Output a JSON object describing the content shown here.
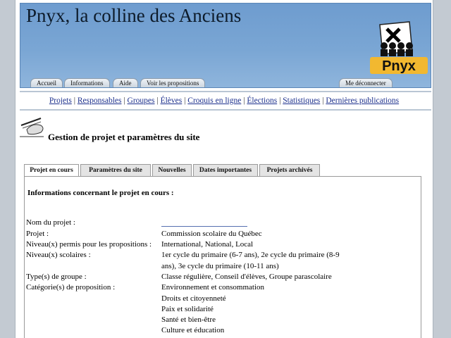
{
  "site": {
    "title": "Pnyx, la colline des Anciens",
    "logo_text": "Pnyx"
  },
  "header_tabs": [
    {
      "label": "Accueil"
    },
    {
      "label": "Informations"
    },
    {
      "label": "Aide"
    },
    {
      "label": "Voir les propositions"
    },
    {
      "label": "Me déconnecter"
    }
  ],
  "nav": [
    {
      "label": "Projets"
    },
    {
      "label": "Responsables"
    },
    {
      "label": "Groupes"
    },
    {
      "label": "Élèves"
    },
    {
      "label": "Croquis en ligne"
    },
    {
      "label": "Élections"
    },
    {
      "label": "Statistiques"
    },
    {
      "label": "Dernières publications"
    }
  ],
  "page": {
    "title": "Gestion de projet et paramètres du site"
  },
  "project_tabs": [
    {
      "label": "Projet en cours",
      "active": true
    },
    {
      "label": "Paramètres du site"
    },
    {
      "label": "Nouvelles"
    },
    {
      "label": "Dates importantes"
    },
    {
      "label": "Projets archivés"
    }
  ],
  "panel": {
    "heading": "Informations concernant le projet en cours :",
    "fields": [
      {
        "label": "Nom du projet :",
        "value": ""
      },
      {
        "label": "Projet :",
        "value": "Commission scolaire du Québec"
      },
      {
        "label": "Niveau(x) permis pour les propositions :",
        "value": "International, National, Local"
      },
      {
        "label": "Niveau(x) scolaires :",
        "value": "1er cycle du primaire (6-7 ans), 2e cycle du primaire (8-9",
        "value2": "ans), 3e cycle du primaire (10-11 ans)"
      },
      {
        "label": "Type(s) de groupe :",
        "value": "Classe régulière, Conseil d'élèves, Groupe parascolaire"
      },
      {
        "label": "Catégorie(s) de proposition :",
        "values": [
          "Environnement et consommation",
          "Droits et citoyenneté",
          "Paix et solidarité",
          "Santé et bien-être",
          "Culture et éducation"
        ]
      }
    ]
  },
  "colors": {
    "header": "#7aa6d4",
    "link": "#1b2f8c"
  }
}
